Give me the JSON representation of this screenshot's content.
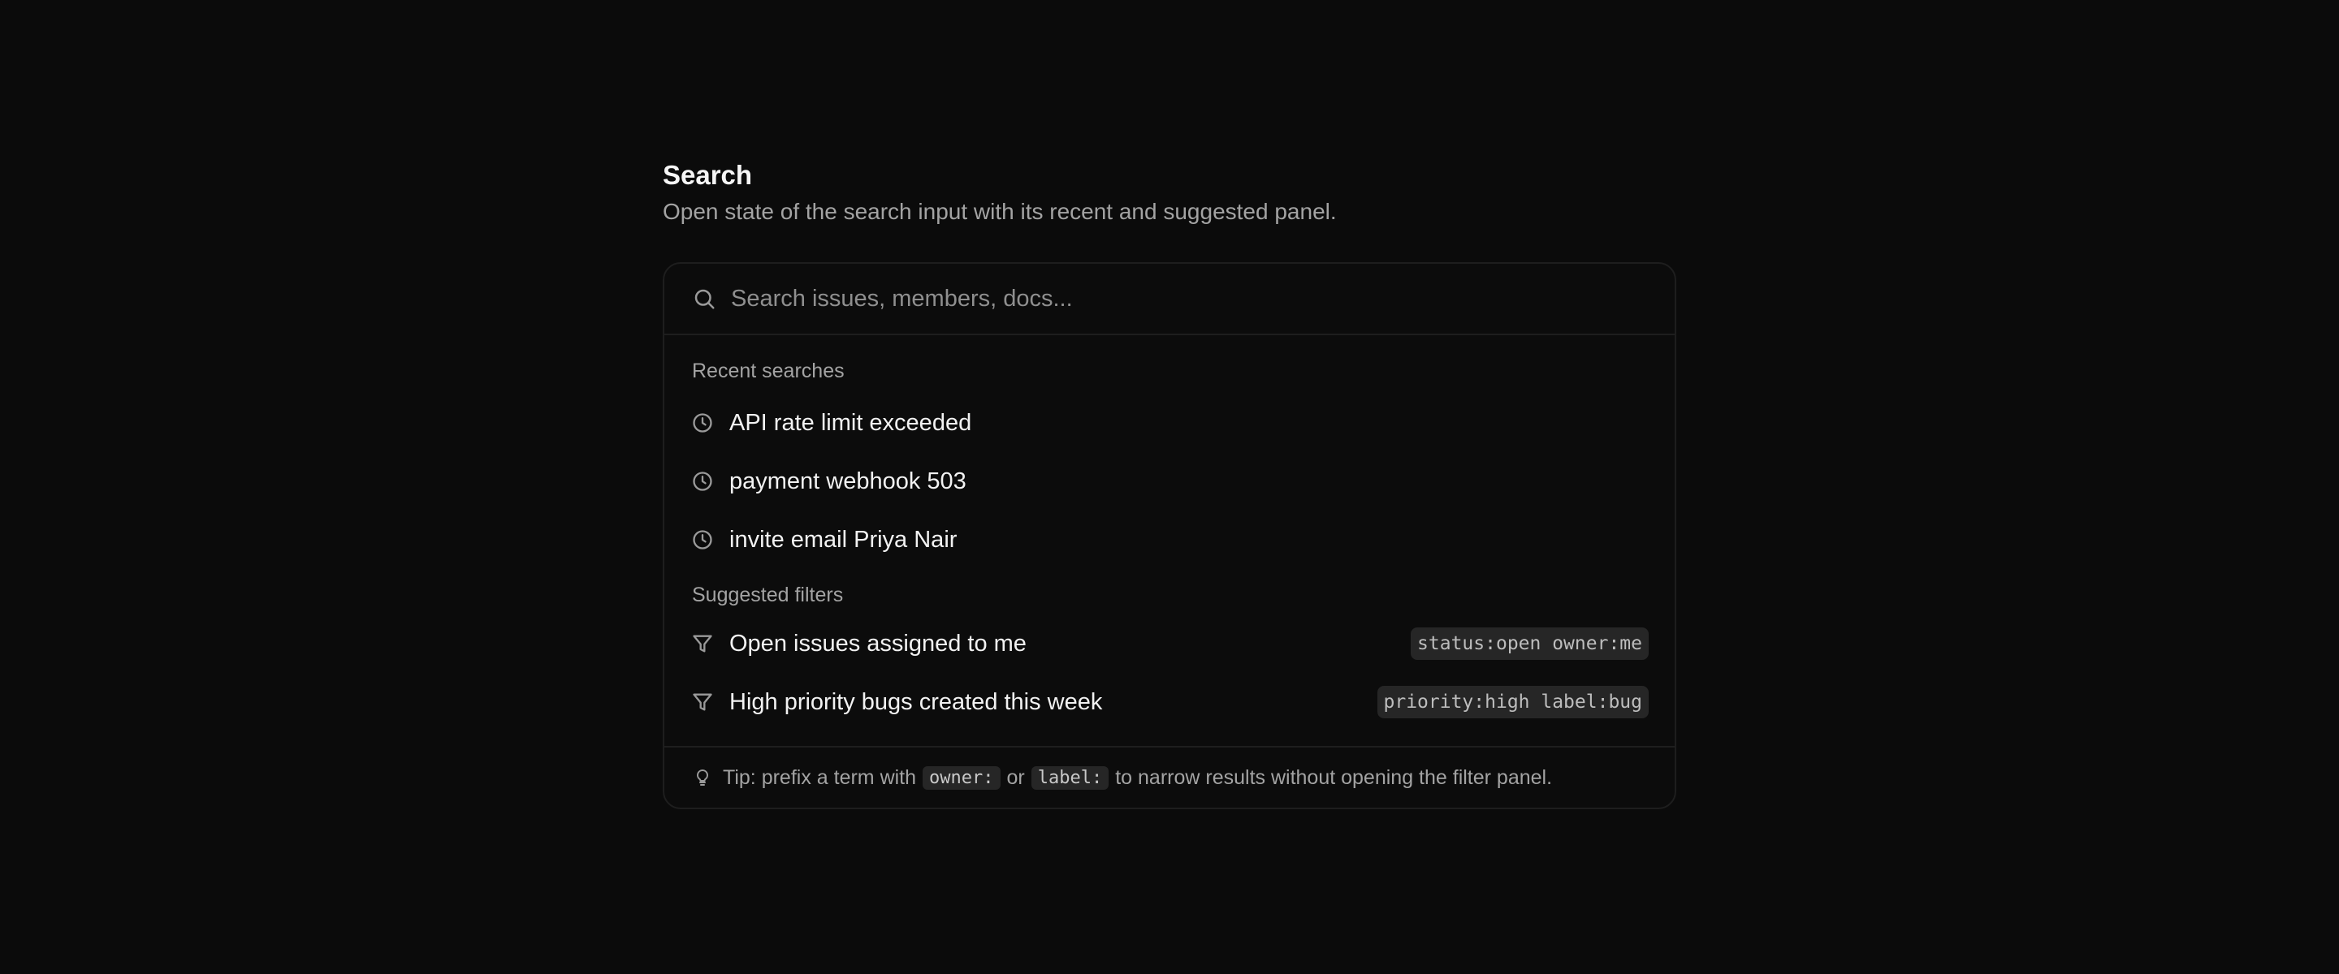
{
  "header": {
    "title": "Search",
    "subtitle": "Open state of the search input with its recent and suggested panel."
  },
  "search": {
    "placeholder": "Search issues, members, docs...",
    "value": "",
    "icon": "search-icon"
  },
  "recent": {
    "label": "Recent searches",
    "icon": "clock-icon",
    "items": [
      {
        "label": "API rate limit exceeded"
      },
      {
        "label": "payment webhook 503"
      },
      {
        "label": "invite email Priya Nair"
      }
    ]
  },
  "suggested": {
    "label": "Suggested filters",
    "icon": "filter-icon",
    "items": [
      {
        "label": "Open issues assigned to me",
        "query": "status:open owner:me"
      },
      {
        "label": "High priority bugs created this week",
        "query": "priority:high label:bug"
      }
    ]
  },
  "tip": {
    "icon": "lightbulb-icon",
    "prefix": "Tip: prefix a term with",
    "code1": "owner:",
    "middle": "or",
    "code2": "label:",
    "suffix": "to narrow results without opening the filter panel."
  },
  "colors": {
    "background": "#0b0b0b",
    "panel_border": "#1e1e1e",
    "text_primary": "#f2f2f2",
    "text_muted": "#a3a3a3",
    "chip_bg": "#262626"
  }
}
